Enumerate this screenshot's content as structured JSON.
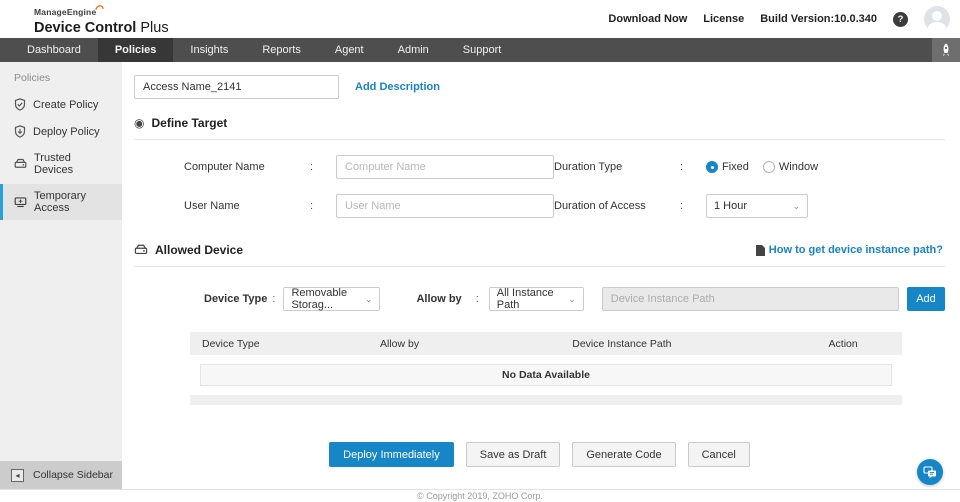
{
  "ui": {
    "colon": ":"
  },
  "topbar": {
    "logo": {
      "brand": "ManageEngine",
      "product_bold": "Device Control",
      "product_light": " Plus"
    },
    "download_now": "Download Now",
    "license": "License",
    "build_version": "Build Version:10.0.340",
    "help_glyph": "?"
  },
  "nav": {
    "items": [
      {
        "label": "Dashboard"
      },
      {
        "label": "Policies"
      },
      {
        "label": "Insights"
      },
      {
        "label": "Reports"
      },
      {
        "label": "Agent"
      },
      {
        "label": "Admin"
      },
      {
        "label": "Support"
      }
    ]
  },
  "sidebar": {
    "section": "Policies",
    "items": [
      {
        "label": "Create Policy"
      },
      {
        "label": "Deploy Policy"
      },
      {
        "label": "Trusted Devices"
      },
      {
        "label": "Temporary Access"
      }
    ],
    "collapse_label": "Collapse Sidebar",
    "collapse_glyph": "◂"
  },
  "form": {
    "access_name": {
      "value": "Access Name_2141"
    },
    "add_description": "Add Description",
    "define_target": {
      "title": "Define Target",
      "icon_glyph": "◉",
      "computer_name": {
        "label": "Computer Name",
        "placeholder": "Computer Name"
      },
      "user_name": {
        "label": "User Name",
        "placeholder": "User Name"
      },
      "duration_type": {
        "label": "Duration Type",
        "options": [
          {
            "label": "Fixed",
            "selected": true
          },
          {
            "label": "Window",
            "selected": false
          }
        ]
      },
      "duration_of_access": {
        "label": "Duration of Access",
        "value": "1 Hour"
      }
    },
    "allowed_device": {
      "title": "Allowed Device",
      "help_link": "How to get device instance path?",
      "device_type": {
        "label": "Device Type",
        "value": "Removable Storag..."
      },
      "allow_by": {
        "label": "Allow by",
        "value": "All Instance Path"
      },
      "instance_path": {
        "placeholder": "Device Instance Path"
      },
      "add_label": "Add",
      "table": {
        "headers": [
          "Device Type",
          "Allow by",
          "Device Instance Path",
          "Action"
        ],
        "empty_text": "No Data Available"
      }
    },
    "actions": {
      "deploy": "Deploy Immediately",
      "save_draft": "Save as Draft",
      "generate": "Generate Code",
      "cancel": "Cancel"
    },
    "chevron": "⌄"
  },
  "footer": {
    "copyright": "© Copyright 2019, ZOHO Corp."
  },
  "colors": {
    "accent": "#1786c7",
    "nav_bg": "#4e4e4e",
    "nav_active": "#373737",
    "sidebar_bg": "#efefef"
  }
}
